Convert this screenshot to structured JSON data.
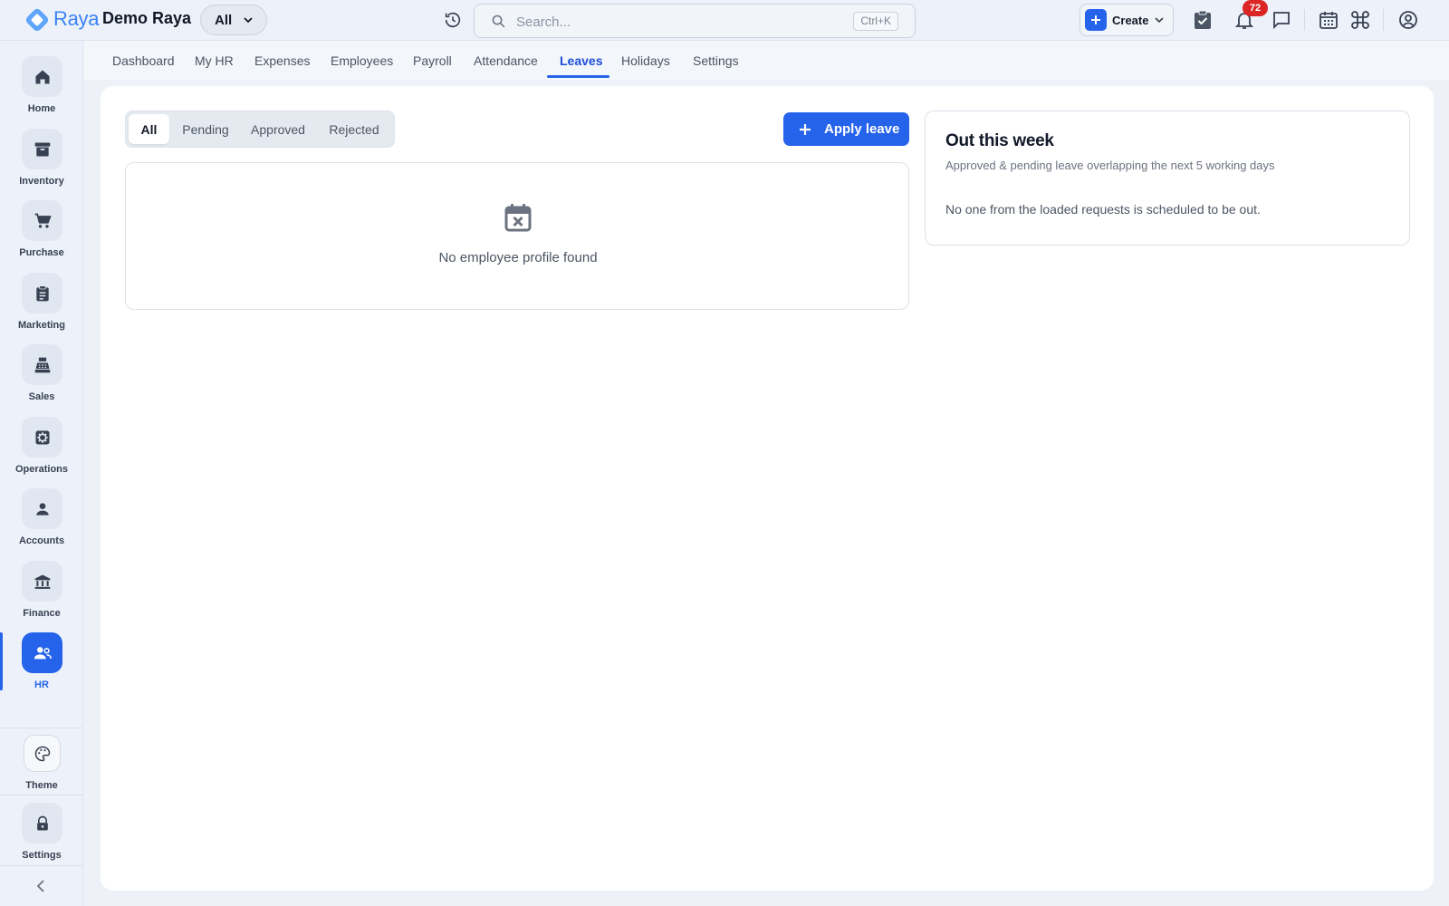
{
  "header": {
    "brand": "Raya",
    "org_name": "Demo Raya",
    "scope_selector": "All",
    "search_placeholder": "Search...",
    "search_shortcut": "Ctrl+K",
    "create_label": "Create",
    "notification_count": "72",
    "accent_color": "#2563eb"
  },
  "sidebar": {
    "items": [
      {
        "label": "Home",
        "icon": "home-icon"
      },
      {
        "label": "Inventory",
        "icon": "archive-icon"
      },
      {
        "label": "Purchase",
        "icon": "cart-icon"
      },
      {
        "label": "Marketing",
        "icon": "clipboard-icon"
      },
      {
        "label": "Sales",
        "icon": "cash-register-icon"
      },
      {
        "label": "Operations",
        "icon": "gear-icon"
      },
      {
        "label": "Accounts",
        "icon": "person-icon"
      },
      {
        "label": "Finance",
        "icon": "bank-icon"
      },
      {
        "label": "HR",
        "icon": "people-icon",
        "active": true
      }
    ],
    "bottom": [
      {
        "label": "Theme",
        "icon": "palette-icon"
      },
      {
        "label": "Settings",
        "icon": "lock-icon"
      }
    ]
  },
  "tabs": [
    {
      "label": "Dashboard"
    },
    {
      "label": "My HR"
    },
    {
      "label": "Expenses"
    },
    {
      "label": "Employees"
    },
    {
      "label": "Payroll"
    },
    {
      "label": "Attendance"
    },
    {
      "label": "Leaves",
      "active": true
    },
    {
      "label": "Holidays"
    },
    {
      "label": "Settings"
    }
  ],
  "leaves": {
    "filters": [
      "All",
      "Pending",
      "Approved",
      "Rejected"
    ],
    "active_filter": "All",
    "apply_button": "Apply leave",
    "empty_message": "No employee profile found"
  },
  "out_this_week": {
    "title": "Out this week",
    "subtitle": "Approved & pending leave overlapping the next 5 working days",
    "message": "No one from the loaded requests is scheduled to be out."
  }
}
